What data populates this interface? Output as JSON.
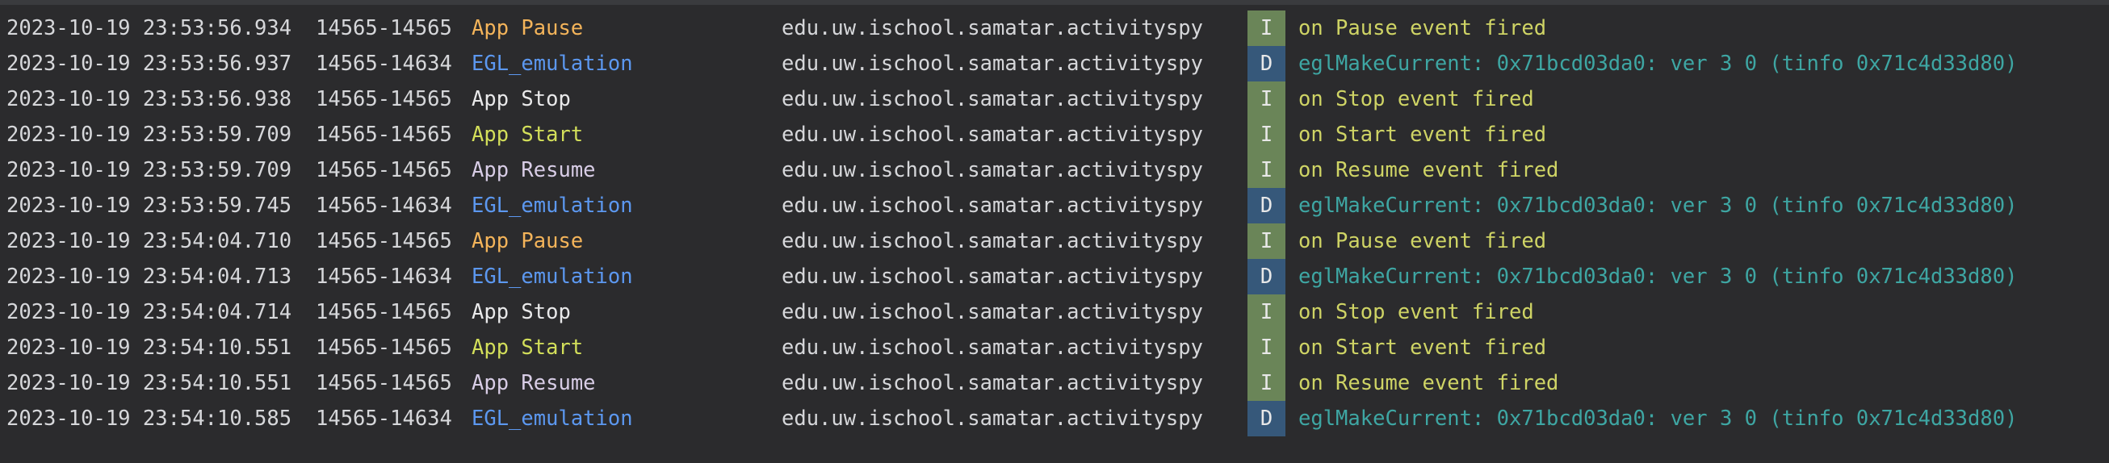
{
  "theme": {
    "background": "#2b2b2d",
    "default_text": "#d6d7da",
    "tag_colors": {
      "App Pause": "#f4b45a",
      "EGL_emulation": "#5c98f0",
      "App Stop": "#e9e9ea",
      "App Start": "#d3df5a",
      "App Resume": "#d8cde6"
    },
    "level_badge_colors": {
      "I": "#6a8558",
      "D": "#36587a"
    },
    "message_colors": {
      "I": "#cfd465",
      "D": "#3ea6a3"
    }
  },
  "logcat": {
    "rows": [
      {
        "timestamp": "2023-10-19 23:53:56.934",
        "pid_tid": "14565-14565",
        "tag": "App Pause",
        "package": "edu.uw.ischool.samatar.activityspy",
        "level": "I",
        "message": "on Pause event fired"
      },
      {
        "timestamp": "2023-10-19 23:53:56.937",
        "pid_tid": "14565-14634",
        "tag": "EGL_emulation",
        "package": "edu.uw.ischool.samatar.activityspy",
        "level": "D",
        "message": "eglMakeCurrent: 0x71bcd03da0: ver 3 0 (tinfo 0x71c4d33d80)"
      },
      {
        "timestamp": "2023-10-19 23:53:56.938",
        "pid_tid": "14565-14565",
        "tag": "App Stop",
        "package": "edu.uw.ischool.samatar.activityspy",
        "level": "I",
        "message": "on Stop event fired"
      },
      {
        "timestamp": "2023-10-19 23:53:59.709",
        "pid_tid": "14565-14565",
        "tag": "App Start",
        "package": "edu.uw.ischool.samatar.activityspy",
        "level": "I",
        "message": "on Start event fired"
      },
      {
        "timestamp": "2023-10-19 23:53:59.709",
        "pid_tid": "14565-14565",
        "tag": "App Resume",
        "package": "edu.uw.ischool.samatar.activityspy",
        "level": "I",
        "message": "on Resume event fired"
      },
      {
        "timestamp": "2023-10-19 23:53:59.745",
        "pid_tid": "14565-14634",
        "tag": "EGL_emulation",
        "package": "edu.uw.ischool.samatar.activityspy",
        "level": "D",
        "message": "eglMakeCurrent: 0x71bcd03da0: ver 3 0 (tinfo 0x71c4d33d80)"
      },
      {
        "timestamp": "2023-10-19 23:54:04.710",
        "pid_tid": "14565-14565",
        "tag": "App Pause",
        "package": "edu.uw.ischool.samatar.activityspy",
        "level": "I",
        "message": "on Pause event fired"
      },
      {
        "timestamp": "2023-10-19 23:54:04.713",
        "pid_tid": "14565-14634",
        "tag": "EGL_emulation",
        "package": "edu.uw.ischool.samatar.activityspy",
        "level": "D",
        "message": "eglMakeCurrent: 0x71bcd03da0: ver 3 0 (tinfo 0x71c4d33d80)"
      },
      {
        "timestamp": "2023-10-19 23:54:04.714",
        "pid_tid": "14565-14565",
        "tag": "App Stop",
        "package": "edu.uw.ischool.samatar.activityspy",
        "level": "I",
        "message": "on Stop event fired"
      },
      {
        "timestamp": "2023-10-19 23:54:10.551",
        "pid_tid": "14565-14565",
        "tag": "App Start",
        "package": "edu.uw.ischool.samatar.activityspy",
        "level": "I",
        "message": "on Start event fired"
      },
      {
        "timestamp": "2023-10-19 23:54:10.551",
        "pid_tid": "14565-14565",
        "tag": "App Resume",
        "package": "edu.uw.ischool.samatar.activityspy",
        "level": "I",
        "message": "on Resume event fired"
      },
      {
        "timestamp": "2023-10-19 23:54:10.585",
        "pid_tid": "14565-14634",
        "tag": "EGL_emulation",
        "package": "edu.uw.ischool.samatar.activityspy",
        "level": "D",
        "message": "eglMakeCurrent: 0x71bcd03da0: ver 3 0 (tinfo 0x71c4d33d80)"
      }
    ]
  }
}
